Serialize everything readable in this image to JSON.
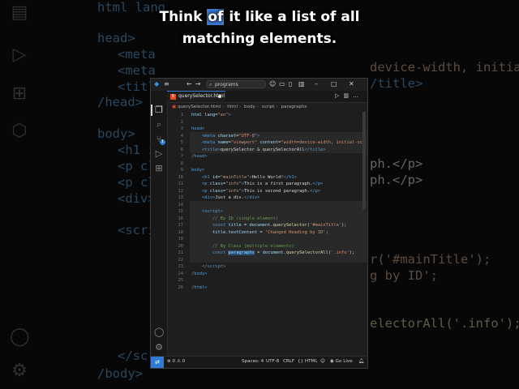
{
  "caption": {
    "before": "Think ",
    "highlight": "of",
    "after": " it like a list of all matching elements."
  },
  "background_code": [
    {
      "text": "html lang",
      "cls": "tag"
    },
    {
      "text": "head>",
      "cls": "tag"
    },
    {
      "text": "<meta",
      "cls": "tag"
    },
    {
      "text": "<meta",
      "cls": "tag"
    },
    {
      "text": "<titl",
      "cls": "tag"
    },
    {
      "text": "/head>",
      "cls": "tag"
    },
    {
      "text": "body>",
      "cls": "tag"
    },
    {
      "text": "<h1 i",
      "cls": "tag"
    },
    {
      "text": "<p cl",
      "cls": "tag"
    },
    {
      "text": "<p cl",
      "cls": "tag"
    },
    {
      "text": "<div>",
      "cls": "tag"
    },
    {
      "text": "<scri",
      "cls": "tag"
    },
    {
      "text": "</scri",
      "cls": "tag"
    },
    {
      "text": "/body>",
      "cls": "tag"
    }
  ],
  "background_right": [
    {
      "text": "device-width, initial-sca",
      "cls": "str"
    },
    {
      "text": "/title>",
      "cls": "tag"
    },
    {
      "text": "ph.</p>",
      "cls": "txt"
    },
    {
      "text": "ph.</p>",
      "cls": "txt"
    },
    {
      "text": "r('#mainTitle');",
      "cls": "str"
    },
    {
      "text": "g by ID';",
      "cls": "str"
    },
    {
      "text": "electorAll('.info');",
      "cls": "fn"
    }
  ],
  "window": {
    "command_center": "programs",
    "tab_label": "querySelector.html",
    "breadcrumb": [
      "querySelector.html",
      "html",
      "body",
      "script",
      "paragraphs"
    ]
  },
  "code_lines": [
    {
      "n": "1",
      "html": "<span class=\"t-attr\">html</span> <span class=\"t-attr\">lang</span>=<span class=\"t-str\">\"en\"</span><span class=\"t-tag\">&gt;</span>"
    },
    {
      "n": "2",
      "html": ""
    },
    {
      "n": "3",
      "html": "<span class=\"t-tag\">head&gt;</span>"
    },
    {
      "n": "4",
      "html": "    <span class=\"t-tag\">&lt;meta</span> <span class=\"t-attr\">charset</span>=<span class=\"t-str\">\"UTF-8\"</span><span class=\"t-tag\">&gt;</span>"
    },
    {
      "n": "5",
      "html": "    <span class=\"t-tag\">&lt;meta</span> <span class=\"t-attr\">name</span>=<span class=\"t-str\">\"viewport\"</span> <span class=\"t-attr\">content</span>=<span class=\"t-str\">\"width=device-width, initial-sca</span>"
    },
    {
      "n": "6",
      "html": "    <span class=\"t-tag\">&lt;title&gt;</span>querySelector &amp; querySelectorAll<span class=\"t-tag\">&lt;/title&gt;</span>"
    },
    {
      "n": "7",
      "html": "<span class=\"t-tag\">/head&gt;</span>"
    },
    {
      "n": "8",
      "html": ""
    },
    {
      "n": "9",
      "html": "<span class=\"t-tag\">body&gt;</span>"
    },
    {
      "n": "10",
      "html": "    <span class=\"t-tag\">&lt;h1</span> <span class=\"t-attr\">id</span>=<span class=\"t-str\">\"mainTitle\"</span><span class=\"t-tag\">&gt;</span>Hello World!<span class=\"t-tag\">&lt;/h1&gt;</span>"
    },
    {
      "n": "11",
      "html": "    <span class=\"t-tag\">&lt;p</span> <span class=\"t-attr\">class</span>=<span class=\"t-str\">\"info\"</span><span class=\"t-tag\">&gt;</span>This is a first paragraph.<span class=\"t-tag\">&lt;/p&gt;</span>"
    },
    {
      "n": "12",
      "html": "    <span class=\"t-tag\">&lt;p</span> <span class=\"t-attr\">class</span>=<span class=\"t-str\">\"info\"</span><span class=\"t-tag\">&gt;</span>This is second paragraph.<span class=\"t-tag\">&lt;/p&gt;</span>"
    },
    {
      "n": "13",
      "html": "    <span class=\"t-tag\">&lt;div&gt;</span>Just a div.<span class=\"t-tag\">&lt;/div&gt;</span>"
    },
    {
      "n": "14",
      "html": ""
    },
    {
      "n": "15",
      "html": "    <span class=\"t-tag\">&lt;script&gt;</span>"
    },
    {
      "n": "16",
      "html": "        <span class=\"t-cmt\">// By ID (single element)</span>"
    },
    {
      "n": "17",
      "html": "        <span class=\"t-kw\">const</span> <span class=\"t-var\">title</span> = <span class=\"t-var\">document</span>.<span class=\"t-fn\">querySelector</span>(<span class=\"t-str\">'#mainTitle'</span>);"
    },
    {
      "n": "18",
      "html": "        <span class=\"t-var\">title</span>.<span class=\"t-var\">textContent</span> = <span class=\"t-str\">'Changed Heading by ID'</span>;"
    },
    {
      "n": "19",
      "html": ""
    },
    {
      "n": "20",
      "html": "        <span class=\"t-cmt\">// By Class (multiple elements)</span>"
    },
    {
      "n": "21",
      "html": "        <span class=\"t-kw\">const</span> <span class=\"sel\">paragraphs</span> = <span class=\"t-var\">document</span>.<span class=\"t-fn\">querySelectorAll</span>(<span class=\"t-str\">'.info'</span>);"
    },
    {
      "n": "22",
      "html": ""
    },
    {
      "n": "23",
      "html": "    <span class=\"t-tag\">&lt;/script&gt;</span>"
    },
    {
      "n": "24",
      "html": "<span class=\"t-tag\">/body&gt;</span>"
    },
    {
      "n": "25",
      "html": ""
    },
    {
      "n": "26",
      "html": "<span class=\"t-tag\">/html&gt;</span>"
    }
  ],
  "status": {
    "errors": "0",
    "warnings": "0",
    "spaces": "Spaces: 4",
    "encoding": "UTF-8",
    "eol": "CRLF",
    "language": "HTML",
    "golive": "Go Live"
  },
  "activity_icons": [
    "files-icon",
    "search-icon",
    "source-control-icon",
    "run-debug-icon",
    "extensions-icon",
    "account-icon",
    "settings-icon"
  ]
}
